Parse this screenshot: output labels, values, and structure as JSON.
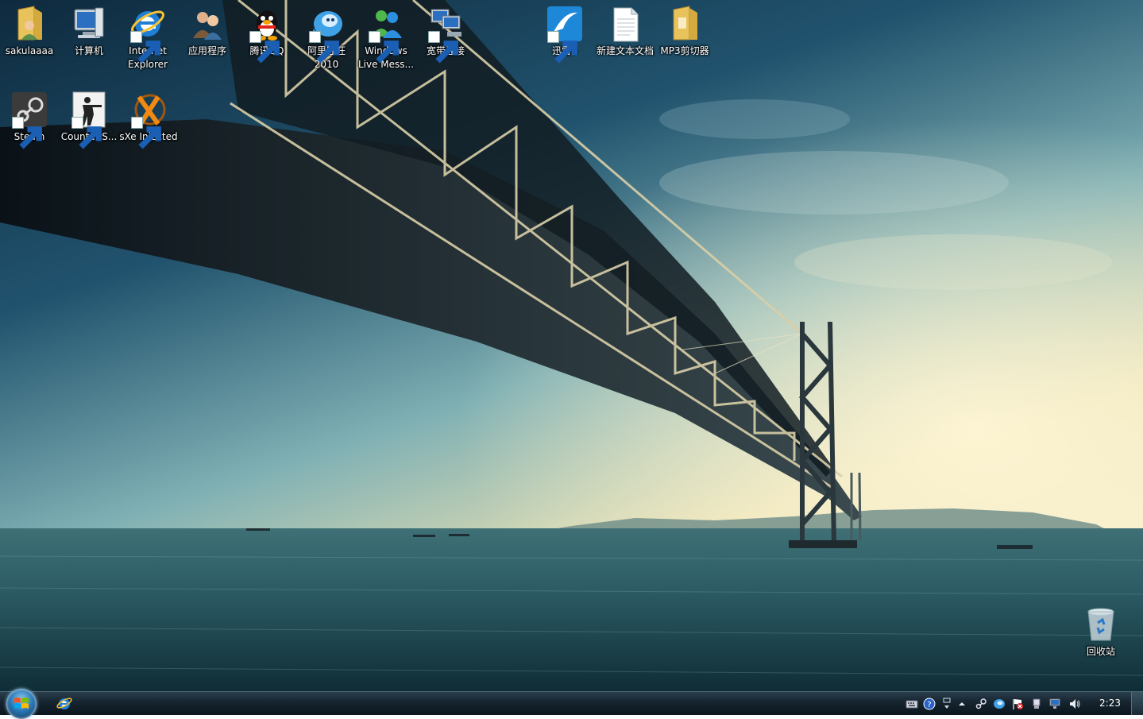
{
  "desktop": {
    "icons": [
      {
        "id": "user",
        "label": "sakulaaaa",
        "icon": "user-folder-icon"
      },
      {
        "id": "computer",
        "label": "计算机",
        "icon": "computer-icon"
      },
      {
        "id": "ie",
        "label": "Internet Explorer",
        "icon": "internet-explorer-icon"
      },
      {
        "id": "apps",
        "label": "应用程序",
        "icon": "users-icon"
      },
      {
        "id": "qq",
        "label": "腾讯QQ",
        "icon": "qq-penguin-icon"
      },
      {
        "id": "aliwangwang",
        "label": "阿里旺旺 2010",
        "icon": "aliwangwang-icon"
      },
      {
        "id": "wlm",
        "label": "Windows Live Mess...",
        "icon": "windows-live-messenger-icon"
      },
      {
        "id": "broadband",
        "label": "宽带连接",
        "icon": "network-connection-icon"
      },
      {
        "id": "xunlei",
        "label": "迅雷5",
        "icon": "xunlei-icon"
      },
      {
        "id": "newtxt",
        "label": "新建文本文档",
        "icon": "text-document-icon"
      },
      {
        "id": "mp3",
        "label": "MP3剪切器",
        "icon": "folder-icon"
      },
      {
        "id": "steam",
        "label": "Steam",
        "icon": "steam-icon"
      },
      {
        "id": "cs",
        "label": "Counter-S...",
        "icon": "counter-strike-icon"
      },
      {
        "id": "sxe",
        "label": "sXe Injected",
        "icon": "sxe-injected-icon"
      },
      {
        "id": "recycle",
        "label": "回收站",
        "icon": "recycle-bin-icon"
      }
    ]
  },
  "taskbar": {
    "start_button": "start-orb-icon",
    "pinned": [
      "internet-explorer-icon"
    ],
    "tray_icons": [
      "keyboard-icon",
      "help-icon",
      "language-bar-icon",
      "show-hidden-icons-arrow",
      "steam-tray-icon",
      "aliwangwang-tray-icon",
      "flag-action-center-icon",
      "usb-device-icon",
      "network-icon",
      "volume-icon"
    ],
    "clock": "2:23"
  }
}
